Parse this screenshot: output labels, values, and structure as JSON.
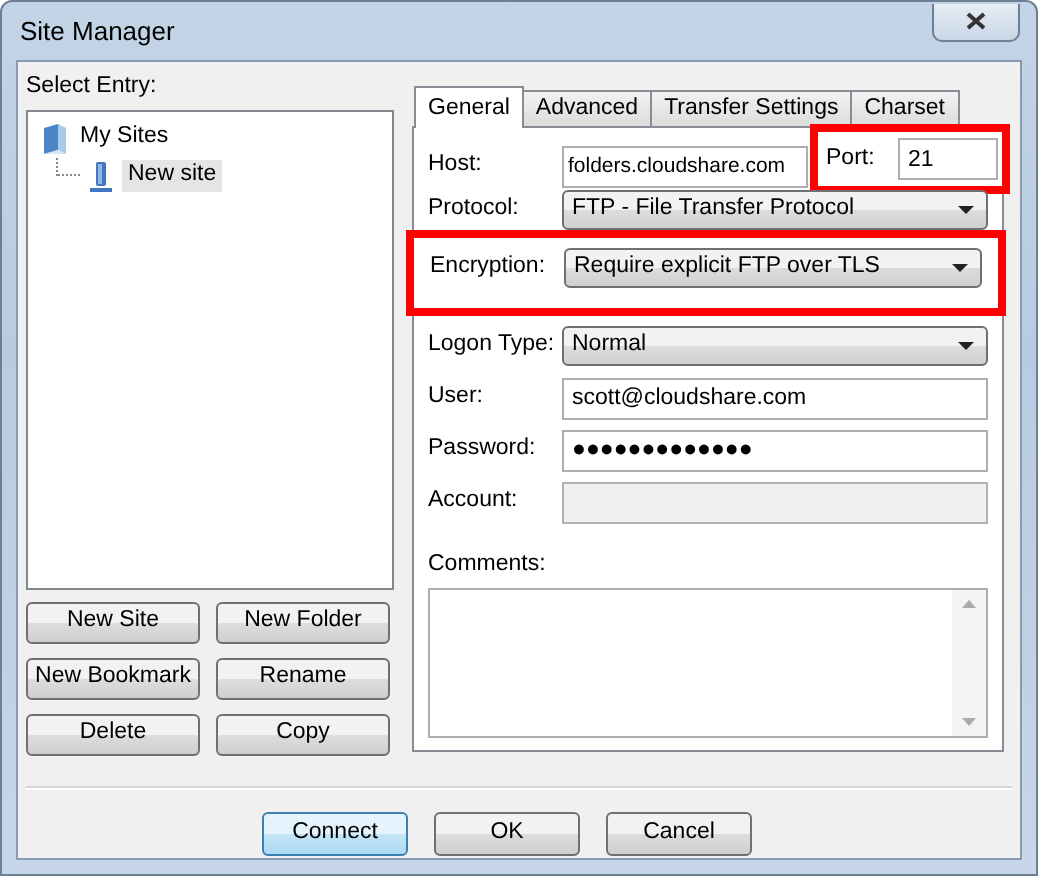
{
  "window": {
    "title": "Site Manager"
  },
  "select_entry": {
    "label": "Select Entry:",
    "tree": [
      {
        "label": "My Sites",
        "kind": "folder",
        "selected": false,
        "children": [
          {
            "label": "New site",
            "kind": "site",
            "selected": true
          }
        ]
      }
    ]
  },
  "entry_buttons": [
    "New Site",
    "New Folder",
    "New Bookmark",
    "Rename",
    "Delete",
    "Copy"
  ],
  "tabs": [
    {
      "label": "General",
      "selected": true
    },
    {
      "label": "Advanced",
      "selected": false
    },
    {
      "label": "Transfer Settings",
      "selected": false
    },
    {
      "label": "Charset",
      "selected": false
    }
  ],
  "general": {
    "host": {
      "label": "Host:",
      "value": "folders.cloudshare.com"
    },
    "port": {
      "label": "Port:",
      "value": "21",
      "highlighted": true
    },
    "protocol": {
      "label": "Protocol:",
      "value": "FTP - File Transfer Protocol",
      "highlighted": false
    },
    "encryption": {
      "label": "Encryption:",
      "value": "Require explicit FTP over TLS",
      "highlighted": true
    },
    "logon_type": {
      "label": "Logon Type:",
      "value": "Normal",
      "highlighted": false
    },
    "user": {
      "label": "User:",
      "value": "scott@cloudshare.com",
      "disabled": false
    },
    "password": {
      "label": "Password:",
      "value": "●●●●●●●●●●●●●",
      "disabled": false
    },
    "account": {
      "label": "Account:",
      "disabled": true
    },
    "comments": {
      "label": "Comments:"
    }
  },
  "dialog_buttons": [
    {
      "label": "Connect",
      "default": true
    },
    {
      "label": "OK",
      "default": false
    },
    {
      "label": "Cancel",
      "default": false
    }
  ]
}
